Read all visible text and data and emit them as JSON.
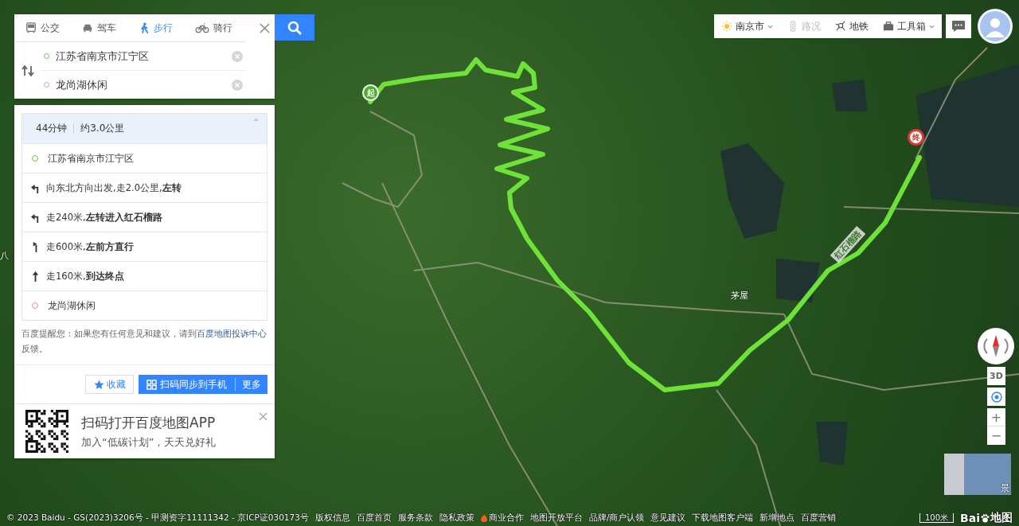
{
  "route_search": {
    "tabs": [
      {
        "kind": "bus",
        "label": "公交",
        "selected": false
      },
      {
        "kind": "car",
        "label": "驾车",
        "selected": false
      },
      {
        "kind": "walk",
        "label": "步行",
        "selected": true
      },
      {
        "kind": "bike",
        "label": "骑行",
        "selected": false
      }
    ],
    "origin": {
      "value": "江苏省南京市江宁区"
    },
    "destination": {
      "value": "龙尚湖休闲"
    }
  },
  "route_panel": {
    "summary": {
      "duration": "44分钟",
      "distance": "约3.0公里"
    },
    "steps": [
      {
        "kind": "start",
        "text": "江苏省南京市江宁区"
      },
      {
        "kind": "left",
        "text": "向东北方向出发,走2.0公里,**左转**"
      },
      {
        "kind": "left",
        "text": "走240米,**左转进入红石榴路**"
      },
      {
        "kind": "slight_left",
        "text": "走600米,**左前方直行**"
      },
      {
        "kind": "straight",
        "text": "走160米,**到达终点**"
      },
      {
        "kind": "end",
        "text": "龙尚湖休闲"
      }
    ],
    "notice": {
      "text": "百度提醒您：如果您有任何意见和建议，请到",
      "link": "百度地图投诉中心",
      "tail": "反馈。"
    },
    "actions": {
      "favorite": "收藏",
      "sync": "扫码同步到手机",
      "more": "更多"
    },
    "promo": {
      "title": "扫码打开百度地图APP",
      "subtitle": "加入“低碳计划”，天天兑好礼"
    }
  },
  "toolbar": [
    {
      "kind": "city",
      "label": "南京市",
      "disabled": false
    },
    {
      "kind": "traffic",
      "label": "路况",
      "disabled": true
    },
    {
      "kind": "subway",
      "label": "地铁",
      "disabled": false
    },
    {
      "kind": "tools",
      "label": "工具箱",
      "disabled": false
    }
  ],
  "map": {
    "place_labels": [
      "茅屋",
      "八"
    ],
    "road_label": "红石榴路",
    "start_marker": "起",
    "end_marker": "终",
    "streetview_label": "景"
  },
  "controls": {
    "three_d": "3D",
    "zoom_in": "+",
    "zoom_out": "−"
  },
  "footer": {
    "copyright": "© 2023 Baidu - GS(2023)3206号 - 甲测资字11111342 - 京ICP证030173号",
    "links": [
      {
        "label": "版权信息",
        "hot": false
      },
      {
        "label": "百度首页",
        "hot": false
      },
      {
        "label": "服务条款",
        "hot": false
      },
      {
        "label": "隐私政策",
        "hot": false
      },
      {
        "label": "商业合作",
        "hot": true
      },
      {
        "label": "地图开放平台",
        "hot": false
      },
      {
        "label": "品牌/商户认领",
        "hot": false
      },
      {
        "label": "意见建议",
        "hot": false
      },
      {
        "label": "下载地图客户端",
        "hot": false
      },
      {
        "label": "新增地点",
        "hot": false
      },
      {
        "label": "百度营销",
        "hot": false
      }
    ],
    "scale": "100米",
    "logo_left": "Bai",
    "logo_right": "地图"
  }
}
